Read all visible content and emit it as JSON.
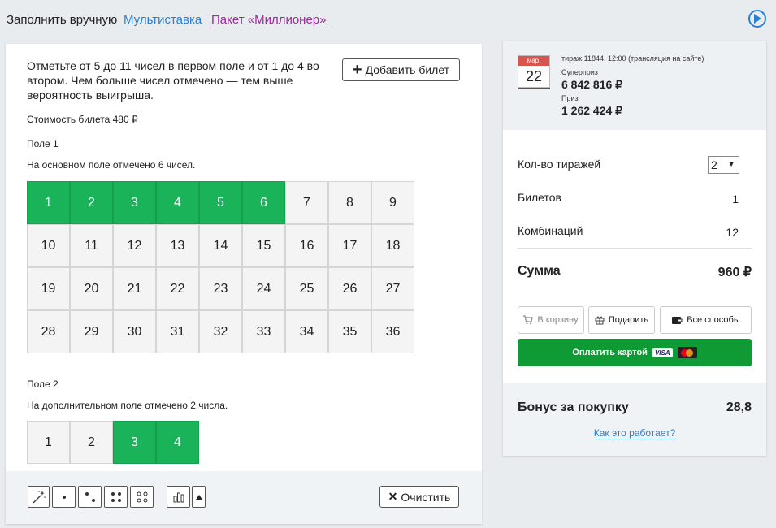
{
  "tabs": {
    "manual": "Заполнить вручную",
    "multi": "Мультиставка",
    "package": "Пакет «Миллионер»"
  },
  "ticket": {
    "instruction": "Отметьте от 5 до 11 чисел в первом поле и от 1 до 4 во втором. Чем больше чисел отмечено — тем выше вероятность выигрыша.",
    "add_ticket": "Добавить билет",
    "cost": "Стоимость билета 480 ₽",
    "field1_title": "Поле 1",
    "field1_status": "На основном поле отмечено 6 чисел.",
    "field1_numbers": [
      1,
      2,
      3,
      4,
      5,
      6,
      7,
      8,
      9,
      10,
      11,
      12,
      13,
      14,
      15,
      16,
      17,
      18,
      19,
      20,
      21,
      22,
      23,
      24,
      25,
      26,
      27,
      28,
      29,
      30,
      31,
      32,
      33,
      34,
      35,
      36
    ],
    "field1_selected": [
      1,
      2,
      3,
      4,
      5,
      6
    ],
    "field2_title": "Поле 2",
    "field2_status": "На дополнительном поле отмечено 2 числа.",
    "field2_numbers": [
      1,
      2,
      3,
      4
    ],
    "field2_selected": [
      3,
      4
    ],
    "clear": "Очистить",
    "tools": [
      "magic-wand-icon",
      "one-dot-icon",
      "two-dots-icon",
      "four-dots-icon",
      "four-circles-icon",
      "chart-icon",
      "arrow-up-icon"
    ]
  },
  "draw": {
    "month": "мар.",
    "day": "22",
    "info": "тираж 11844, 12:00 (трансляция на сайте)",
    "superprize_label": "Суперприз",
    "superprize_value": "6 842 816 ₽",
    "prize_label": "Приз",
    "prize_value": "1 262 424 ₽"
  },
  "order": {
    "draws_label": "Кол-во тиражей",
    "draws_value": "2",
    "tickets_label": "Билетов",
    "tickets_value": "1",
    "combos_label": "Комбинаций",
    "combos_value": "12",
    "sum_label": "Сумма",
    "sum_value": "960 ₽",
    "cart": "В корзину",
    "gift": "Подарить",
    "all_methods": "Все способы",
    "pay_card": "Оплатить картой",
    "visa": "VISA"
  },
  "bonus": {
    "label": "Бонус за покупку",
    "value": "28,8",
    "how": "Как это работает?"
  },
  "colors": {
    "selected": "#1bb35a",
    "pay": "#0e9a34",
    "link": "#2a7fd4",
    "package": "#9b2a9b"
  }
}
